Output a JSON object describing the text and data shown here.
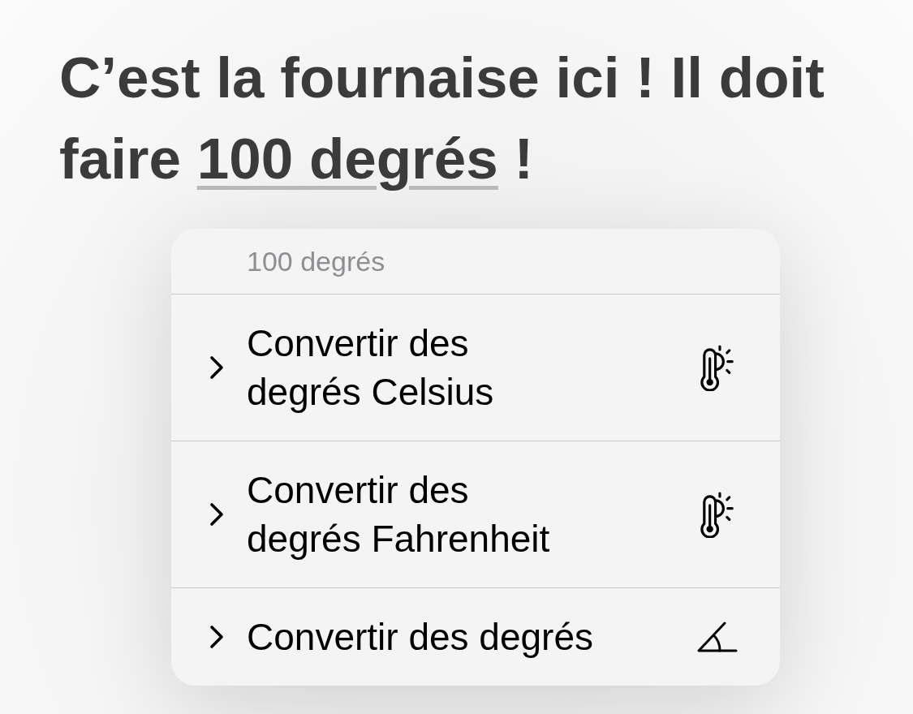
{
  "heading": {
    "text_before": "C’est la fournaise ici ! Il doit faire ",
    "detected_text": "100 degrés",
    "text_after": " !"
  },
  "menu": {
    "title": "100 degrés",
    "items": [
      {
        "label": "Convertir des degrés Celsius",
        "has_submenu": true,
        "kind": "temperature"
      },
      {
        "label": "Convertir des degrés Fahrenheit",
        "has_submenu": true,
        "kind": "temperature"
      },
      {
        "label": "Convertir des degrés",
        "has_submenu": true,
        "kind": "angle"
      }
    ]
  }
}
